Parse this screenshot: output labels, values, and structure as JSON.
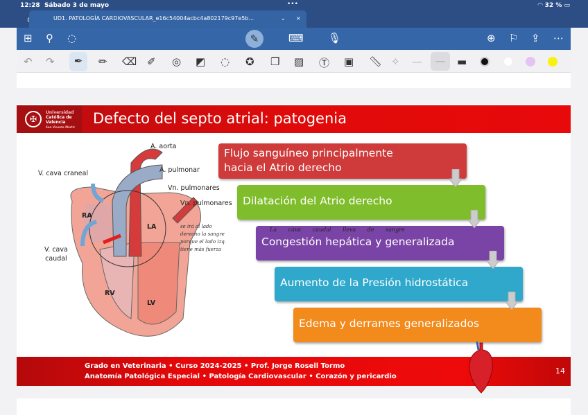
{
  "status": {
    "time": "12:28",
    "date": "Sábado 3 de mayo",
    "battery": "32 %"
  },
  "tab": {
    "title": "UD1. PATOLOGÍA CARDIOVASCULAR_e16c54004acbc4a802179c97e5b...",
    "chevron": "⌄",
    "close": "×"
  },
  "toolbar": {
    "left_icons": [
      "grid-icon",
      "search-icon",
      "lasso-icon"
    ],
    "center_icons": [
      "pen-mode-icon",
      "keyboard-icon",
      "microphone-icon"
    ],
    "right_icons": [
      "add-page-icon",
      "bookmark-icon",
      "share-icon",
      "more-icon"
    ]
  },
  "pen_toolbar": {
    "tools": [
      "undo-icon",
      "redo-icon",
      "fountain-pen-icon",
      "pencil-icon",
      "eraser-icon",
      "highlighter-icon",
      "shape-icon",
      "shapes-icon",
      "lasso-select-icon",
      "sticker-icon",
      "copy-icon",
      "image-icon",
      "text-icon",
      "camera-icon",
      "ruler-icon",
      "laser-icon"
    ],
    "colors": [
      "#111111",
      "#ffffff",
      "#e3c4f4",
      "#f7f20f"
    ]
  },
  "slide": {
    "title": "Defecto del septo atrial: patogenia",
    "logo": {
      "line1": "Universidad",
      "line2": "Católica de",
      "line3": "Valencia",
      "line4": "San Vicente Mártir"
    },
    "labels": {
      "aorta": "A. aorta",
      "pulmonar": "A. pulmonar",
      "vcc": "V. cava craneal",
      "vnp1": "Vn. pulmonares",
      "vnp2": "Vn. pulmonares",
      "vcaudal1": "V. cava",
      "vcaudal2": "caudal",
      "ra": "RA",
      "la": "LA",
      "rv": "RV",
      "lv": "LV"
    },
    "handwriting": {
      "note": "se irá al lado derecho la sangre porque el lado izq. tiene más fuerza",
      "purple": "La cava caudal lleva de sangre"
    },
    "steps": [
      {
        "text1": "Flujo sanguíneo principalmente",
        "text2": "hacia el Atrio derecho",
        "color": "#cf3b3b"
      },
      {
        "text": "Dilatación del Atrio derecho",
        "color": "#7fbd2c"
      },
      {
        "text": "Congestión hepática y generalizada",
        "color": "#7a43a6"
      },
      {
        "text": "Aumento de la Presión hidrostática",
        "color": "#2fa8cc"
      },
      {
        "text": "Edema y derrames generalizados",
        "color": "#f28a1c"
      }
    ],
    "footer": {
      "line1": "Grado en Veterinaria • Curso 2024-2025 • Prof. Jorge Rosell Tormo",
      "line2": "Anatomía Patológica Especial • Patología Cardiovascular • Corazón y pericardio",
      "page": "14"
    }
  }
}
